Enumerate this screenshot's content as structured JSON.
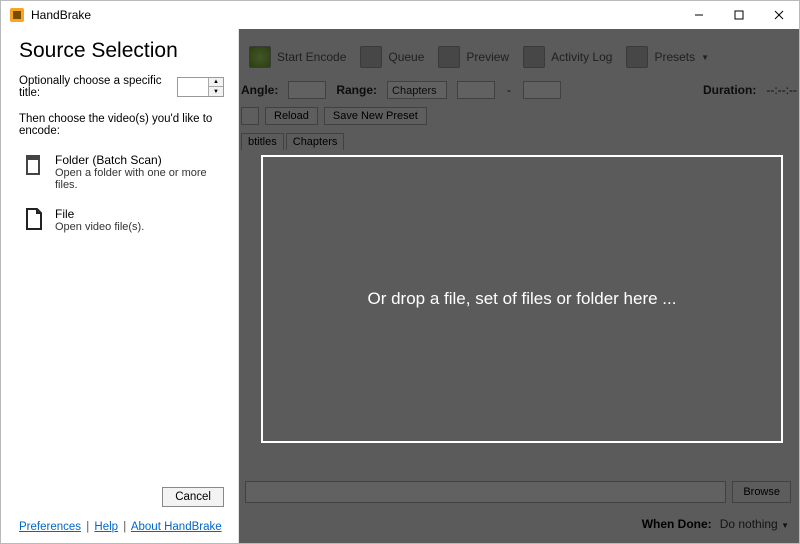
{
  "app": {
    "title": "HandBrake"
  },
  "panel": {
    "heading": "Source Selection",
    "title_label": "Optionally choose a specific title:",
    "title_value": "",
    "instruction": "Then choose the video(s) you'd like to encode:",
    "folder": {
      "title": "Folder (Batch Scan)",
      "desc": "Open a folder with one or more files."
    },
    "file": {
      "title": "File",
      "desc": "Open video file(s)."
    },
    "cancel": "Cancel",
    "links": {
      "prefs": "Preferences",
      "help": "Help",
      "about": "About HandBrake"
    }
  },
  "toolbar": {
    "start": "Start Encode",
    "queue": "Queue",
    "preview": "Preview",
    "activity": "Activity Log",
    "presets": "Presets"
  },
  "props": {
    "angle": "Angle:",
    "range": "Range:",
    "range_mode": "Chapters",
    "duration": "Duration:",
    "duration_value": "--:--:--"
  },
  "preset": {
    "reload": "Reload",
    "save": "Save New Preset"
  },
  "tabs": {
    "subtitles": "btitles",
    "chapters": "Chapters"
  },
  "browse": "Browse",
  "when_done": {
    "label": "When Done:",
    "value": "Do nothing"
  },
  "dropzone": "Or drop a file, set of files or folder here ..."
}
